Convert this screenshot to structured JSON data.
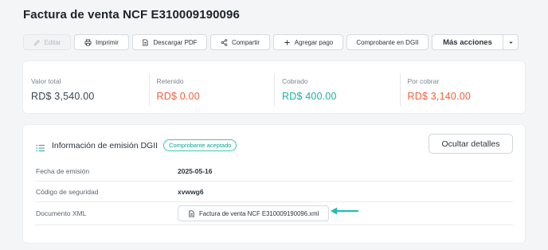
{
  "page": {
    "title": "Factura de venta NCF E310009190096"
  },
  "toolbar": {
    "edit": "Editar",
    "print": "Imprimir",
    "download_pdf": "Descargar PDF",
    "share": "Compartir",
    "add_payment": "Agregar pago",
    "dgii_receipt": "Comprobante en DGII",
    "more_actions": "Más acciones"
  },
  "totals": [
    {
      "label": "Valor total",
      "value": "RD$ 3,540.00",
      "color": "#3a4550"
    },
    {
      "label": "Retenido",
      "value": "RD$ 0.00",
      "color": "#f0603c"
    },
    {
      "label": "Cobrado",
      "value": "RD$ 400.00",
      "color": "#19b3a6"
    },
    {
      "label": "Por cobrar",
      "value": "RD$ 3,140.00",
      "color": "#f0603c"
    }
  ],
  "info": {
    "title": "Información de emisión DGII",
    "badge": "Comprobante aceptado",
    "hide_button": "Ocultar detalles",
    "rows": [
      {
        "label": "Fecha de emisión",
        "value": "2025-05-16"
      },
      {
        "label": "Código de seguridad",
        "value": "xvwwg6"
      },
      {
        "label": "Documento XML",
        "value": "Factura de venta NCF E310009190096.xml"
      }
    ]
  },
  "icons": {
    "edit": "pencil-icon",
    "print": "printer-icon",
    "pdf": "document-icon",
    "share": "share-icon",
    "add": "plus-icon",
    "caret": "chevron-down-icon",
    "list": "list-icon",
    "xml": "document-icon",
    "arrow": "arrow-left-icon"
  },
  "colors": {
    "accent": "#19b3a6",
    "negative": "#f0603c"
  }
}
